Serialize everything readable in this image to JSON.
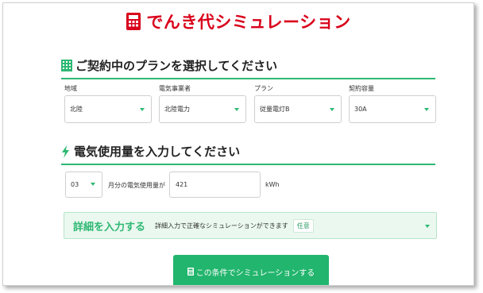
{
  "header": {
    "title": "でんき代シミュレーション",
    "icon": "calculator-icon",
    "accent_color": "#d9001b"
  },
  "plan_section": {
    "heading": "ご契約中のプランを選択してください",
    "icon": "plan-icon",
    "fields": [
      {
        "label": "地域",
        "value": "北陸"
      },
      {
        "label": "電気事業者",
        "value": "北陸電力"
      },
      {
        "label": "プラン",
        "value": "従量電灯B"
      },
      {
        "label": "契約容量",
        "value": "30A"
      }
    ]
  },
  "usage_section": {
    "heading": "電気使用量を入力してください",
    "icon": "lightning-icon",
    "month_value": "03",
    "month_suffix": "月分の電気使用量が",
    "usage_value": "421",
    "unit": "kWh"
  },
  "detail": {
    "title": "詳細を入力する",
    "description": "詳細入力で正確なシミュレーションができます",
    "badge": "任意"
  },
  "submit": {
    "label": "この条件でシミュレーションする",
    "icon": "calculator-icon",
    "color": "#22b56d"
  },
  "theme": {
    "green": "#2eb873"
  }
}
